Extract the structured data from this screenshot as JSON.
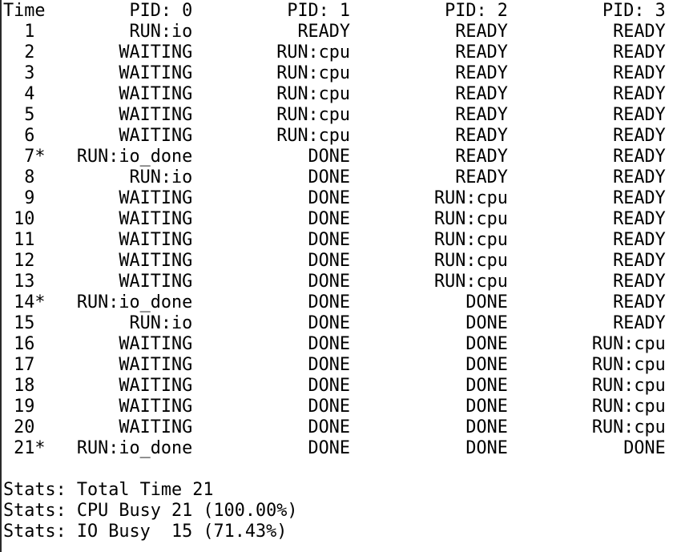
{
  "terminal": {
    "lines": [
      "Time        PID: 0         PID: 1         PID: 2         PID: 3",
      "  1         RUN:io          READY          READY          READY",
      "  2        WAITING        RUN:cpu          READY          READY",
      "  3        WAITING        RUN:cpu          READY          READY",
      "  4        WAITING        RUN:cpu          READY          READY",
      "  5        WAITING        RUN:cpu          READY          READY",
      "  6        WAITING        RUN:cpu          READY          READY",
      "  7*   RUN:io_done           DONE          READY          READY",
      "  8         RUN:io           DONE          READY          READY",
      "  9        WAITING           DONE        RUN:cpu          READY",
      " 10        WAITING           DONE        RUN:cpu          READY",
      " 11        WAITING           DONE        RUN:cpu          READY",
      " 12        WAITING           DONE        RUN:cpu          READY",
      " 13        WAITING           DONE        RUN:cpu          READY",
      " 14*   RUN:io_done           DONE           DONE          READY",
      " 15         RUN:io           DONE           DONE          READY",
      " 16        WAITING           DONE           DONE        RUN:cpu",
      " 17        WAITING           DONE           DONE        RUN:cpu",
      " 18        WAITING           DONE           DONE        RUN:cpu",
      " 19        WAITING           DONE           DONE        RUN:cpu",
      " 20        WAITING           DONE           DONE        RUN:cpu",
      " 21*   RUN:io_done           DONE           DONE           DONE",
      "",
      "Stats: Total Time 21",
      "Stats: CPU Busy 21 (100.00%)",
      "Stats: IO Busy  15 (71.43%)"
    ]
  }
}
